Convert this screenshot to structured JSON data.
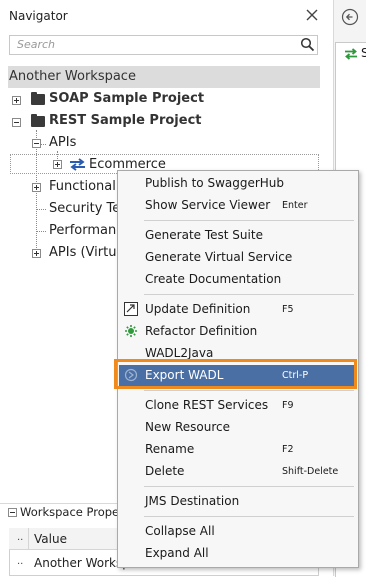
{
  "navigator": {
    "title": "Navigator",
    "search_placeholder": "Search",
    "right_panel_letter": "S"
  },
  "tree": {
    "workspace": "Another Workspace",
    "soap_project": "SOAP Sample Project",
    "rest_project": "REST Sample Project",
    "apis": "APIs",
    "ecommerce": "Ecommerce",
    "functional": "Functional T",
    "security": "Security Tes",
    "performance": "Performanc",
    "apis_virtual": "APIs (Virtua"
  },
  "workspace_properties": {
    "title": "Workspace Proper",
    "col_dots": "..",
    "col_value": "Value",
    "row_dots": "..",
    "row_value": "Another Workspace"
  },
  "context_menu": {
    "items": [
      {
        "label": "Publish to SwaggerHub",
        "shortcut": ""
      },
      {
        "label": "Show Service Viewer",
        "shortcut": "Enter"
      },
      {
        "label": "Generate Test Suite",
        "shortcut": ""
      },
      {
        "label": "Generate Virtual Service",
        "shortcut": ""
      },
      {
        "label": "Create Documentation",
        "shortcut": ""
      },
      {
        "label": "Update Definition",
        "shortcut": "F5",
        "icon": "update-definition-icon"
      },
      {
        "label": "Refactor Definition",
        "shortcut": "",
        "icon": "refactor-icon"
      },
      {
        "label": "WADL2Java",
        "shortcut": ""
      },
      {
        "label": "Export WADL",
        "shortcut": "Ctrl-P",
        "icon": "export-icon",
        "highlighted": true
      },
      {
        "label": "Clone REST Services",
        "shortcut": "F9"
      },
      {
        "label": "New Resource",
        "shortcut": ""
      },
      {
        "label": "Rename",
        "shortcut": "F2"
      },
      {
        "label": "Delete",
        "shortcut": "Shift-Delete"
      },
      {
        "label": "JMS Destination",
        "shortcut": ""
      },
      {
        "label": "Collapse All",
        "shortcut": ""
      },
      {
        "label": "Expand All",
        "shortcut": ""
      }
    ]
  },
  "colors": {
    "highlight": "#4a6fa5",
    "callout_outline": "#f08a1c",
    "workspace_row": "#dcdcdc",
    "rest_icon_blue": "#2a5db0"
  }
}
